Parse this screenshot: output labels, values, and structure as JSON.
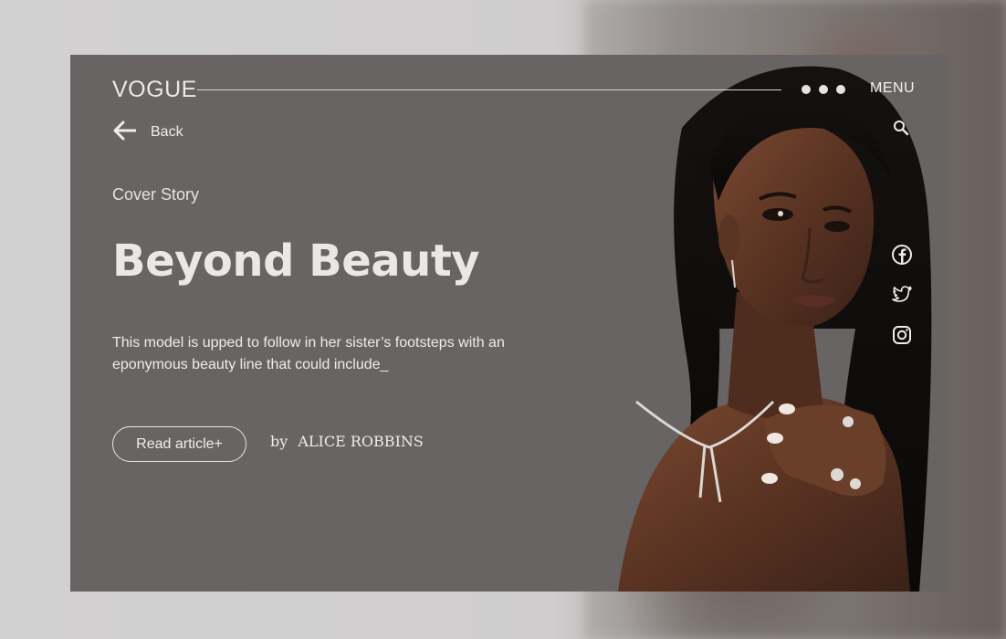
{
  "header": {
    "logo": "VOGUE",
    "menu_label": "MENU",
    "pager_dots": 3
  },
  "nav": {
    "back_label": "Back"
  },
  "article": {
    "kicker": "Cover Story",
    "headline": "Beyond Beauty",
    "excerpt": "This model is upped to follow in her sister’s footsteps with an eponymous beauty line that could include_",
    "read_button": "Read article+",
    "byline_prefix": "by",
    "author": "ALICE ROBBINS"
  },
  "icons": {
    "back": "arrow-left-icon",
    "search": "search-icon",
    "social": [
      "facebook-icon",
      "twitter-icon",
      "instagram-icon"
    ]
  },
  "colors": {
    "page_bg": "#d0cfcf",
    "card_bg": "#686463",
    "text_light": "#ece8e6"
  }
}
